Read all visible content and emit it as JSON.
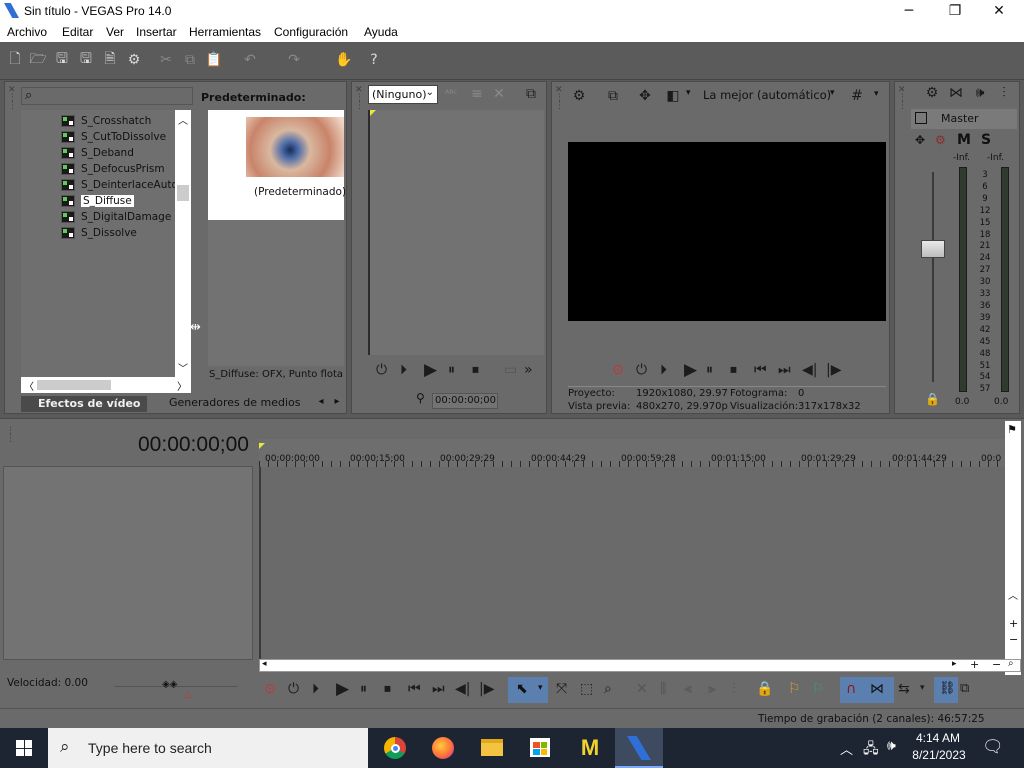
{
  "window": {
    "title": "Sin título - VEGAS Pro 14.0"
  },
  "menu": [
    "Archivo",
    "Editar",
    "Ver",
    "Insertar",
    "Herramientas",
    "Configuración",
    "Ayuda"
  ],
  "explorer": {
    "items": [
      "S_Crosshatch",
      "S_CutToDissolve",
      "S_Deband",
      "S_DefocusPrism",
      "S_DeinterlaceAuto",
      "S_Diffuse",
      "S_DigitalDamage",
      "S_Dissolve"
    ],
    "selected_index": 5,
    "preset_header": "Predeterminado:",
    "preset_label": "(Predeterminado)",
    "status": "S_Diffuse: OFX, Punto flota",
    "tabs": [
      "Efectos de vídeo",
      "Generadores de medios"
    ]
  },
  "trimmer": {
    "dropdown": "(Ninguno)",
    "timecode": "00:00:00;00"
  },
  "preview": {
    "quality": "La mejor (automático)",
    "project_label": "Proyecto:",
    "project_value": "1920x1080, 29.97",
    "preview_label": "Vista previa:",
    "preview_value": "480x270, 29.970p",
    "frame_label": "Fotograma:",
    "frame_value": "0",
    "display_label": "Visualización:",
    "display_value": "317x178x32"
  },
  "master": {
    "title": "Master",
    "m": "M",
    "s": "S",
    "inf_left": "-Inf.",
    "inf_right": "-Inf.",
    "scale": [
      "3",
      "6",
      "9",
      "12",
      "15",
      "18",
      "21",
      "24",
      "27",
      "30",
      "33",
      "36",
      "39",
      "42",
      "45",
      "48",
      "51",
      "54",
      "57"
    ],
    "val_left": "0.0",
    "val_right": "0.0"
  },
  "timeline": {
    "timecode": "00:00:00;00",
    "ruler": [
      "00:00:00;00",
      "00:00:15;00",
      "00:00:29;29",
      "00:00:44;29",
      "00:00:59;28",
      "00:01:15;00",
      "00:01:29;29",
      "00:01:44;29",
      "00:0"
    ],
    "velocity": "Velocidad: 0.00",
    "record_time": "Tiempo de grabación (2 canales): 46:57:25"
  },
  "taskbar": {
    "search_placeholder": "Type here to search",
    "time": "4:14 AM",
    "date": "8/21/2023"
  },
  "colors": {
    "accent_blue": "#2f6fd6",
    "record_red": "#d23a3a"
  }
}
